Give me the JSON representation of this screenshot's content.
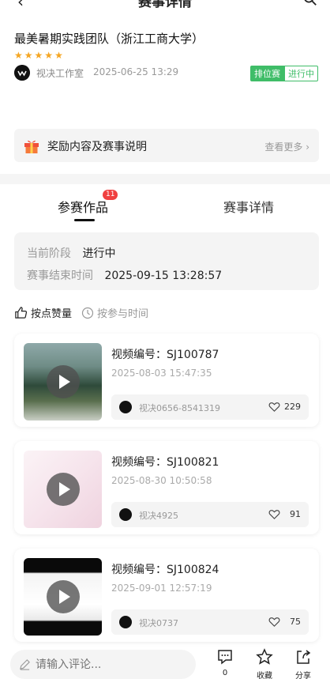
{
  "header": {
    "title": "赛事详情"
  },
  "contest": {
    "team_name": "最美暑期实践团队（浙江工商大学）",
    "stars": 5,
    "organizer": "视决工作室",
    "published": "2025-06-25 13:29",
    "badge_type": "排位赛",
    "badge_state": "进行中"
  },
  "reward": {
    "label": "奖励内容及赛事说明",
    "more": "查看更多"
  },
  "tabs": [
    {
      "label": "参赛作品",
      "count": "11"
    },
    {
      "label": "赛事详情"
    }
  ],
  "stage": {
    "stage_key": "当前阶段",
    "stage_value": "进行中",
    "end_key": "赛事结束时间",
    "end_value": "2025-09-15 13:28:57"
  },
  "sort": {
    "by_likes": "按点赞量",
    "by_time": "按参与时间"
  },
  "videos": [
    {
      "code": "视频编号：SJ100787",
      "date": "2025-08-03 15:47:35",
      "author": "视决0656-8541319",
      "likes": "229"
    },
    {
      "code": "视频编号：SJ100821",
      "date": "2025-08-30 10:50:58",
      "author": "视决4925",
      "likes": "91"
    },
    {
      "code": "视频编号：SJ100824",
      "date": "2025-09-01 12:57:19",
      "author": "视决0737",
      "likes": "75"
    }
  ],
  "bottom": {
    "comment_placeholder": "请输入评论...",
    "comment_count": "0",
    "favorite": "收藏",
    "share": "分享"
  }
}
